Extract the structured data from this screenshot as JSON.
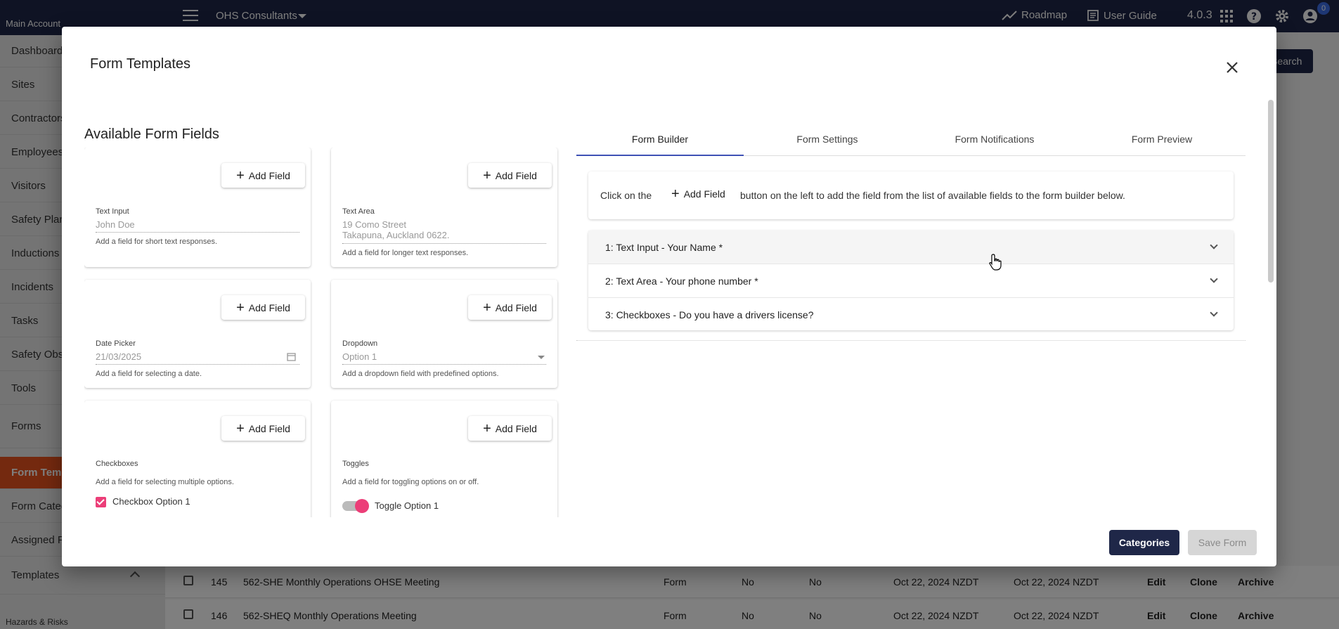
{
  "topbar": {
    "account_label": "Main Account",
    "org_name": "OHS Consultants",
    "roadmap": "Roadmap",
    "user_guide": "User Guide",
    "version": "4.0.3",
    "notifications": "0"
  },
  "sidebar": {
    "items": [
      "Dashboard",
      "Sites",
      "Contractors",
      "Employees",
      "Visitors",
      "Safety Plans",
      "Inductions",
      "Incidents",
      "Tasks",
      "Safety Obs",
      "Tools",
      "Forms",
      "Form Temp",
      "Form Categ",
      "Assigned F",
      "Templates"
    ],
    "hazards": "Hazards & Risks"
  },
  "background": {
    "search": "Search",
    "rows": [
      {
        "id": "145",
        "name": "562-SHE Monthly Operations OHSE Meeting",
        "type": "Form",
        "c1": "No",
        "c2": "No",
        "created": "Oct 22, 2024 NZDT",
        "updated": "Oct 22, 2024 NZDT",
        "edit": "Edit",
        "clone": "Clone",
        "archive": "Archive"
      },
      {
        "id": "146",
        "name": "562-SHEQ Monthly Operations Meeting",
        "type": "Form",
        "c1": "No",
        "c2": "No",
        "created": "Oct 22, 2024 NZDT",
        "updated": "Oct 22, 2024 NZDT",
        "edit": "Edit",
        "clone": "Clone",
        "archive": "Archive"
      }
    ]
  },
  "modal": {
    "title": "Form Templates",
    "available_title": "Available Form Fields",
    "add_field": "Add Field",
    "fields": {
      "text_input": {
        "label": "Text Input",
        "value": "John Doe",
        "desc": "Add a field for short text responses."
      },
      "text_area": {
        "label": "Text Area",
        "value1": "19 Como Street",
        "value2": "Takapuna, Auckland 0622.",
        "desc": "Add a field for longer text responses."
      },
      "date_picker": {
        "label": "Date Picker",
        "value": "21/03/2025",
        "desc": "Add a field for selecting a date."
      },
      "dropdown": {
        "label": "Dropdown",
        "value": "Option 1",
        "desc": "Add a dropdown field with predefined options."
      },
      "checkboxes": {
        "label": "Checkboxes",
        "desc": "Add a field for selecting multiple options.",
        "option": "Checkbox Option 1"
      },
      "toggles": {
        "label": "Toggles",
        "desc": "Add a field for toggling options on or off.",
        "option": "Toggle Option 1"
      }
    },
    "tabs": [
      "Form Builder",
      "Form Settings",
      "Form Notifications",
      "Form Preview"
    ],
    "instructions": {
      "prefix": "Click on the",
      "button": "Add Field",
      "suffix": "button on the left to add the field from the list of available fields to the form builder below."
    },
    "form_fields": [
      "1: Text Input - Your Name  *",
      "2: Text Area - Your phone number *",
      "3: Checkboxes - Do you have a drivers license?"
    ],
    "categories_button": "Categories",
    "save_button": "Save Form"
  },
  "colors": {
    "navy": "#1f2748",
    "accent_orange": "#e8531e",
    "pink": "#ec3e78",
    "tab_indicator": "#3f51b5"
  }
}
